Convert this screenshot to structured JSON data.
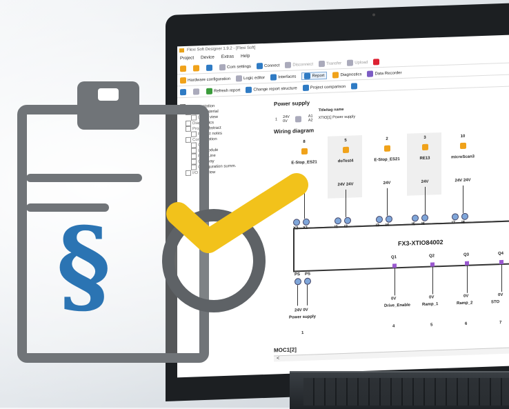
{
  "app": {
    "title": "Flexi Soft Designer 1.9.2 - [Flexi Soft]",
    "menu": [
      "Project",
      "Device",
      "Extras",
      "Help"
    ],
    "toolbar1": [
      "Com settings",
      "Connect",
      "Disconnect",
      "Transfer",
      "Upload"
    ],
    "toolbar2": [
      "Hardware configuration",
      "Logic editor",
      "Interfaces",
      "Report",
      "Diagnostics",
      "Data Recorder"
    ],
    "toolbar3": [
      "Refresh report",
      "Change report structure",
      "Project comparison"
    ]
  },
  "tree": [
    {
      "label": "Documentation",
      "indent": 0
    },
    {
      "label": "Bill of material",
      "indent": 1
    },
    {
      "label": "Detail view",
      "indent": 2
    },
    {
      "label": "Diagnostics",
      "indent": 1
    },
    {
      "label": "Project abstract",
      "indent": 1
    },
    {
      "label": "Project notes",
      "indent": 2
    },
    {
      "label": "Configuration",
      "indent": 1
    },
    {
      "label": "CPU",
      "indent": 2
    },
    {
      "label": "I/O module",
      "indent": 2
    },
    {
      "label": "Flexi Line",
      "indent": 2
    },
    {
      "label": "Gateway",
      "indent": 2
    },
    {
      "label": "Configuration summ.",
      "indent": 2
    },
    {
      "label": "I/O overview",
      "indent": 1
    }
  ],
  "power_supply": {
    "heading": "Power supply",
    "col_header": "Title/tag name",
    "rows": [
      {
        "num": "1",
        "v1": "24V",
        "v2": "0V",
        "a1": "A1",
        "a2": "A2",
        "name": "XTIO[1] Power supply"
      }
    ]
  },
  "wiring": {
    "heading": "Wiring diagram",
    "columns": [
      {
        "num": "8",
        "label": "E-Stop_ES21",
        "volt": ""
      },
      {
        "num": "5",
        "label": "doTest4",
        "volt": "24V 24V"
      },
      {
        "num": "2",
        "label": "E-Stop_ES21",
        "volt": "24V"
      },
      {
        "num": "3",
        "label": "RE13",
        "volt": "24V"
      },
      {
        "num": "10",
        "label": "microScan3",
        "volt": "24V 24V"
      }
    ],
    "terminals": [
      "X2",
      "X1",
      "I1",
      "I2",
      "I3",
      "I4",
      "I5",
      "I6",
      "I7",
      "I8"
    ],
    "device": "FX3-XTIO84002",
    "supply_top": [
      "PS",
      "PS"
    ],
    "supply_label": "24V  0V",
    "supply_name": "Power supply",
    "supply_num": "1",
    "outputs": [
      {
        "q": "Q1",
        "v": "0V",
        "name": "Drive_Enable",
        "num": "4"
      },
      {
        "q": "Q2",
        "v": "0V",
        "name": "Ramp_1",
        "num": "5"
      },
      {
        "q": "Q3",
        "v": "0V",
        "name": "Ramp_2",
        "num": "6"
      },
      {
        "q": "Q4",
        "v": "0V",
        "name": "STO",
        "num": "7"
      }
    ]
  },
  "footer_label": "MOC1[2]",
  "scroll_arrow": "<",
  "icons": {
    "paragraph": "§",
    "colors": {
      "clipboard": "#707478",
      "paragraph": "#2b74b3",
      "check": "#f2c21b",
      "circle": "#5e6266"
    }
  }
}
